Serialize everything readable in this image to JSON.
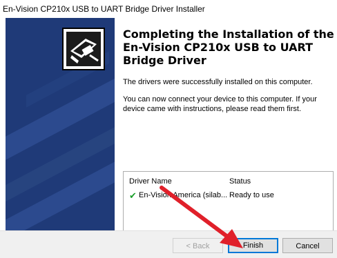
{
  "window": {
    "title": "En-Vision CP210x USB to UART Bridge Driver Installer"
  },
  "page": {
    "heading": "Completing the Installation of the En-Vision CP210x USB to UART Bridge Driver",
    "message1": "The drivers were successfully installed on this computer.",
    "message2": "You can now connect your device to this computer. If your device came with instructions, please read them first."
  },
  "driver_list": {
    "headers": [
      "Driver Name",
      "Status"
    ],
    "rows": [
      {
        "name": "En-Vision America (silab...",
        "status": "Ready to use"
      }
    ]
  },
  "buttons": {
    "back": "< Back",
    "finish": "Finish",
    "cancel": "Cancel"
  },
  "colors": {
    "sidebar": "#1f3a78",
    "accent": "#0078d7",
    "annotation_arrow": "#e0202a",
    "check": "#1a9e2a"
  },
  "icons": {
    "installer": "computer-install-icon",
    "check": "check-icon"
  }
}
